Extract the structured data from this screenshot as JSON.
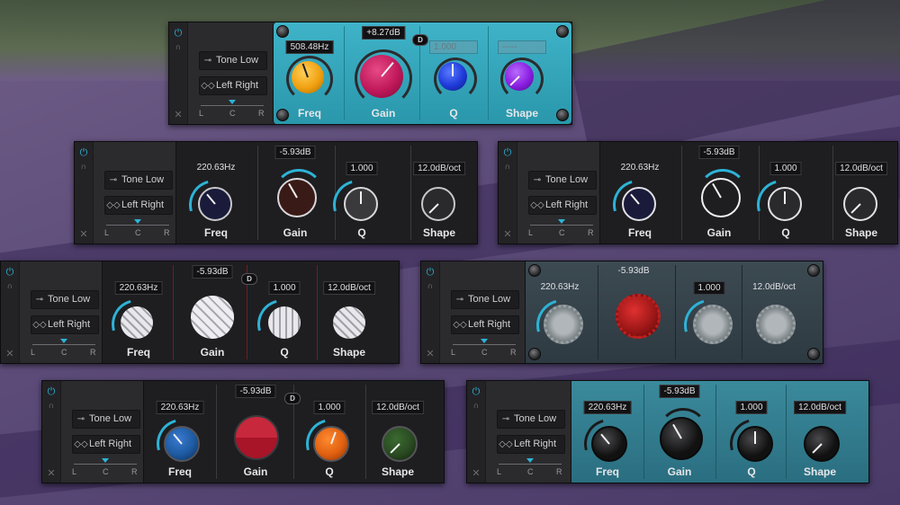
{
  "background": {
    "colors": {
      "purple": "#5e4d7a",
      "dark_purple": "#3c2c5a",
      "green_top": "#4b6a3c"
    }
  },
  "devices": [
    {
      "input": "Tone Low",
      "routing": "Left Right",
      "pan": {
        "left": "L",
        "center": "C",
        "right": "R"
      },
      "freq_value": "508.48Hz",
      "gain_value": "+8.27dB",
      "q_value": "1.000",
      "shape_value": "-----",
      "d_badge": "D",
      "labels": {
        "freq": "Freq",
        "gain": "Gain",
        "q": "Q",
        "shape": "Shape"
      },
      "theme": "teal-colored",
      "knob_colors": {
        "freq": "#f0a010",
        "gain": "#c0185a",
        "q": "#1e3ad8",
        "shape": "#8a1ee0"
      }
    },
    {
      "input": "Tone Low",
      "routing": "Left Right",
      "pan": {
        "left": "L",
        "center": "C",
        "right": "R"
      },
      "freq_value": "220.63Hz",
      "gain_value": "-5.93dB",
      "q_value": "1.000",
      "shape_value": "12.0dB/oct",
      "labels": {
        "freq": "Freq",
        "gain": "Gain",
        "q": "Q",
        "shape": "Shape"
      },
      "theme": "dark",
      "knob_colors": {
        "freq": "#1a1a3a",
        "gain": "#3a1a16",
        "q": "#3a3a3c",
        "shape": "#2a2a2c"
      }
    },
    {
      "input": "Tone Low",
      "routing": "Left Right",
      "pan": {
        "left": "L",
        "center": "C",
        "right": "R"
      },
      "freq_value": "220.63Hz",
      "gain_value": "-5.93dB",
      "q_value": "1.000",
      "shape_value": "12.0dB/oct",
      "labels": {
        "freq": "Freq",
        "gain": "Gain",
        "q": "Q",
        "shape": "Shape"
      },
      "theme": "dark-white",
      "knob_colors": {
        "freq": "#1a1a3a",
        "gain": "#1e1e20",
        "q": "#2a2a2c",
        "shape": "#2a2a2c"
      }
    },
    {
      "input": "Tone Low",
      "routing": "Left Right",
      "pan": {
        "left": "L",
        "center": "C",
        "right": "R"
      },
      "freq_value": "220.63Hz",
      "gain_value": "-5.93dB",
      "q_value": "1.000",
      "shape_value": "12.0dB/oct",
      "d_badge": "D",
      "labels": {
        "freq": "Freq",
        "gain": "Gain",
        "q": "Q",
        "shape": "Shape"
      },
      "theme": "silver-red",
      "knob_colors": {
        "freq": "#d8d8dc",
        "gain": "#e4e4e8",
        "q": "#d8d8dc",
        "shape": "#d8d8dc"
      }
    },
    {
      "input": "Tone Low",
      "routing": "Left Right",
      "pan": {
        "left": "L",
        "center": "C",
        "right": "R"
      },
      "freq_value": "220.63Hz",
      "gain_value": "-5.93dB",
      "q_value": "1.000",
      "shape_value": "12.0dB/oct",
      "labels": {
        "freq": "",
        "gain": "",
        "q": "",
        "shape": ""
      },
      "theme": "slate",
      "knob_colors": {
        "freq": "#8a9094",
        "gain": "#a01818",
        "q": "#8a9094",
        "shape": "#8a9094"
      }
    },
    {
      "input": "Tone Low",
      "routing": "Left Right",
      "pan": {
        "left": "L",
        "center": "C",
        "right": "R"
      },
      "freq_value": "220.63Hz",
      "gain_value": "-5.93dB",
      "q_value": "1.000",
      "shape_value": "12.0dB/oct",
      "d_badge": "D",
      "labels": {
        "freq": "Freq",
        "gain": "Gain",
        "q": "Q",
        "shape": "Shape"
      },
      "theme": "dark-colored",
      "knob_colors": {
        "freq": "#1d5aa0",
        "gain": "#b81c30",
        "q": "#e06010",
        "shape": "#2a4a22"
      }
    },
    {
      "input": "Tone Low",
      "routing": "Left Right",
      "pan": {
        "left": "L",
        "center": "C",
        "right": "R"
      },
      "freq_value": "220.63Hz",
      "gain_value": "-5.93dB",
      "q_value": "1.000",
      "shape_value": "12.0dB/oct",
      "labels": {
        "freq": "Freq",
        "gain": "Gain",
        "q": "Q",
        "shape": "Shape"
      },
      "theme": "teal-black",
      "knob_colors": {
        "freq": "#111",
        "gain": "#111",
        "q": "#111",
        "shape": "#111"
      }
    }
  ]
}
